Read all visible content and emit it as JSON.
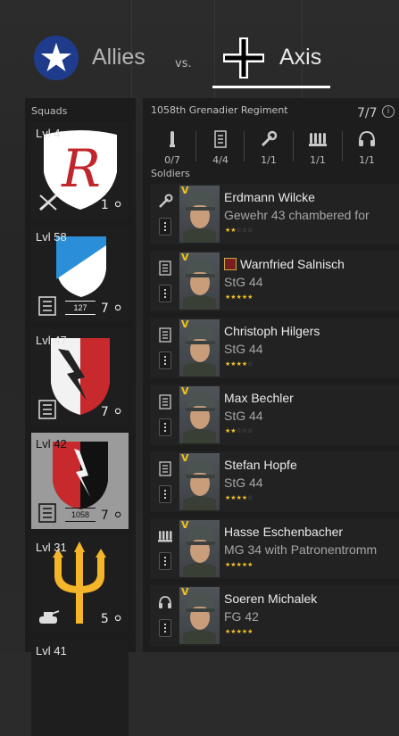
{
  "header": {
    "allies_label": "Allies",
    "vs_label": "vs.",
    "axis_label": "Axis",
    "selected_side": "Axis"
  },
  "squads": {
    "title": "Squads",
    "items": [
      {
        "level": "Lvl 4",
        "count": "1",
        "emblem": "red-r-shield-icon",
        "type": "sniper-icon",
        "tag": ""
      },
      {
        "level": "Lvl 58",
        "count": "7",
        "emblem": "blue-white-shield-icon",
        "type": "list-icon",
        "tag": "127"
      },
      {
        "level": "Lvl 47",
        "count": "7",
        "emblem": "red-white-lightning-shield-icon",
        "type": "list-icon",
        "tag": ""
      },
      {
        "level": "Lvl 42",
        "count": "7",
        "emblem": "black-red-lightning-shield-icon",
        "type": "list-icon",
        "tag": "1058"
      },
      {
        "level": "Lvl 31",
        "count": "5",
        "emblem": "yellow-trident-icon",
        "type": "tank-icon",
        "tag": ""
      },
      {
        "level": "Lvl 41",
        "count": "",
        "emblem": "",
        "type": "",
        "tag": ""
      }
    ]
  },
  "regiment": {
    "title": "1058th Grenadier Regiment",
    "count": "7/7",
    "info_icon": "info-icon",
    "slots": [
      {
        "icon": "ammo-icon",
        "value": "0/7"
      },
      {
        "icon": "list-icon",
        "value": "4/4"
      },
      {
        "icon": "wrench-icon",
        "value": "1/1"
      },
      {
        "icon": "ammo-belt-icon",
        "value": "1/1"
      },
      {
        "icon": "headset-icon",
        "value": "1/1"
      }
    ],
    "soldiers_title": "Soldiers",
    "soldiers": [
      {
        "rank": "V",
        "name": "Erdmann Wilcke",
        "weapon": "Gewehr 43 chambered for",
        "stars": 2,
        "class_icon": "wrench-icon",
        "medal": false
      },
      {
        "rank": "V",
        "name": "Warnfried Salnisch",
        "weapon": "StG 44",
        "stars": 5,
        "class_icon": "list-icon",
        "medal": true
      },
      {
        "rank": "V",
        "name": "Christoph Hilgers",
        "weapon": "StG 44",
        "stars": 4,
        "class_icon": "list-icon",
        "medal": false
      },
      {
        "rank": "V",
        "name": "Max Bechler",
        "weapon": "StG 44",
        "stars": 2,
        "class_icon": "list-icon",
        "medal": false
      },
      {
        "rank": "V",
        "name": "Stefan Hopfe",
        "weapon": "StG 44",
        "stars": 4,
        "class_icon": "list-icon",
        "medal": false
      },
      {
        "rank": "V",
        "name": "Hasse Eschenbacher",
        "weapon": "MG 34 with Patronentromm",
        "stars": 5,
        "class_icon": "ammo-belt-icon",
        "medal": false
      },
      {
        "rank": "V",
        "name": "Soeren Michalek",
        "weapon": "FG 42",
        "stars": 5,
        "class_icon": "headset-icon",
        "medal": false
      }
    ]
  },
  "colors": {
    "allies_blue": "#1f3c8c",
    "star_gold": "#f2c12e",
    "rank_gold": "#f0c419",
    "active_squad": "#9b9b9b"
  }
}
